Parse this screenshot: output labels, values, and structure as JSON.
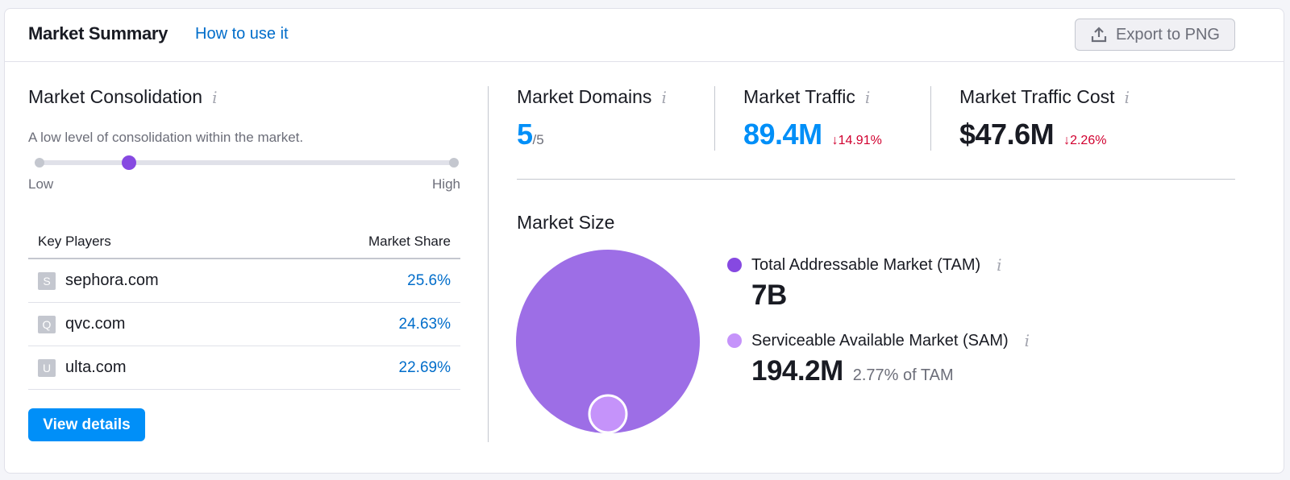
{
  "header": {
    "title": "Market Summary",
    "how_to_link": "How to use it",
    "export_button": "Export to PNG",
    "export_icon": "upload-icon"
  },
  "consolidation": {
    "title": "Market Consolidation",
    "info_icon": "info-icon",
    "description": "A low level of consolidation within the market.",
    "slider_level_fraction": 0.216,
    "low_label": "Low",
    "high_label": "High"
  },
  "key_players": {
    "col_domain": "Key Players",
    "col_share": "Market Share",
    "rows": [
      {
        "favicon_letter": "S",
        "domain": "sephora.com",
        "share": "25.6%"
      },
      {
        "favicon_letter": "Q",
        "domain": "qvc.com",
        "share": "24.63%"
      },
      {
        "favicon_letter": "U",
        "domain": "ulta.com",
        "share": "22.69%"
      }
    ],
    "view_details_button": "View details"
  },
  "metrics": {
    "domains": {
      "title": "Market Domains",
      "value": "5",
      "total": "/5"
    },
    "traffic": {
      "title": "Market Traffic",
      "value": "89.4M",
      "delta": "↓14.91%"
    },
    "traffic_cost": {
      "title": "Market Traffic Cost",
      "value": "$47.6M",
      "delta": "↓2.26%"
    }
  },
  "market_size": {
    "title": "Market Size",
    "tam": {
      "label": "Total Addressable Market (TAM)",
      "value": "7B",
      "color": "#8649e1"
    },
    "sam": {
      "label": "Serviceable Available Market (SAM)",
      "value": "194.2M",
      "pct_of_tam": "2.77% of TAM",
      "color": "#c593fa"
    },
    "bubble_colors": {
      "tam_fill": "#9d6ee6",
      "sam_fill": "#c593fa"
    }
  },
  "colors": {
    "accent_blue": "#008ff8",
    "link_blue": "#006dca",
    "negative_red": "#d1002f",
    "slider_thumb": "#8649e1"
  }
}
